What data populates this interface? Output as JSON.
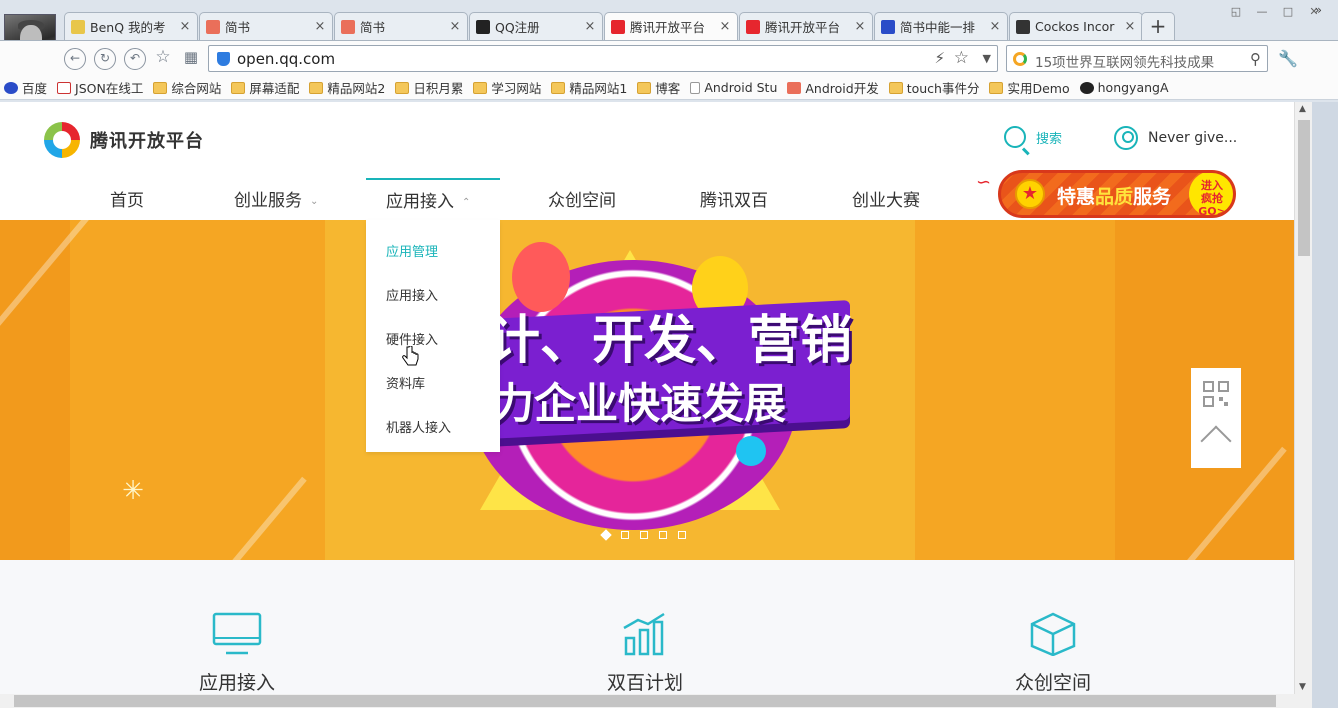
{
  "browser": {
    "tabs": [
      {
        "label": "BenQ 我的考",
        "icon": "benq-page-icon",
        "color": "#e8c64a"
      },
      {
        "label": "简书",
        "icon": "jianshu-icon",
        "color": "#ea6f5a"
      },
      {
        "label": "简书",
        "icon": "jianshu-icon",
        "color": "#ea6f5a"
      },
      {
        "label": "QQ注册",
        "icon": "qq-penguin-icon",
        "color": "#222222"
      },
      {
        "label": "腾讯开放平台",
        "icon": "tencent-open-icon",
        "color": "#e6262e",
        "active": true
      },
      {
        "label": "腾讯开放平台",
        "icon": "tencent-open-icon",
        "color": "#e6262e"
      },
      {
        "label": "简书中能一排",
        "icon": "baidu-paw-icon",
        "color": "#2a4cc8"
      },
      {
        "label": "Cockos Incor",
        "icon": "cockos-icon",
        "color": "#333333"
      }
    ],
    "new_tab_label": "+",
    "url": "open.qq.com",
    "search_text": "15项世界互联网领先科技成果",
    "bookmarks": [
      {
        "label": "百度",
        "icon": "paw"
      },
      {
        "label": "JSON在线工",
        "icon": "json"
      },
      {
        "label": "综合网站",
        "icon": "folder"
      },
      {
        "label": "屏幕适配",
        "icon": "folder"
      },
      {
        "label": "精品网站2",
        "icon": "folder"
      },
      {
        "label": "日积月累",
        "icon": "folder"
      },
      {
        "label": "学习网站",
        "icon": "folder"
      },
      {
        "label": "精品网站1",
        "icon": "folder"
      },
      {
        "label": "博客",
        "icon": "folder"
      },
      {
        "label": "Android Stu",
        "icon": "page"
      },
      {
        "label": "Android开发",
        "icon": "jian"
      },
      {
        "label": "touch事件分",
        "icon": "folder"
      },
      {
        "label": "实用Demo",
        "icon": "folder"
      },
      {
        "label": "hongyangA",
        "icon": "gh"
      }
    ],
    "bookmarks_more": "»"
  },
  "site": {
    "logo_text": "腾讯开放平台",
    "search_label": "搜索",
    "user_label": "Never give...",
    "nav": [
      {
        "label": "首页",
        "has_chevron": false
      },
      {
        "label": "创业服务",
        "has_chevron": true
      },
      {
        "label": "应用接入",
        "has_chevron": true,
        "open": true
      },
      {
        "label": "众创空间",
        "has_chevron": false
      },
      {
        "label": "腾讯双百",
        "has_chevron": false
      },
      {
        "label": "创业大赛",
        "has_chevron": false
      }
    ],
    "promo": {
      "text_a": "特惠",
      "text_b": "品质",
      "text_c": "服务",
      "go_line1": "进入",
      "go_line2": "疯抢",
      "go_line3": "GO>"
    },
    "dropdown": [
      {
        "label": "应用管理",
        "active": true
      },
      {
        "label": "应用接入",
        "active": false
      },
      {
        "label": "硬件接入",
        "active": false
      },
      {
        "label": "资料库",
        "active": false
      },
      {
        "label": "机器人接入",
        "active": false
      }
    ],
    "banner": {
      "line1": "计、开发、营销",
      "line2": "力企业快速发展",
      "slides": 5,
      "current_slide": 1
    },
    "features": [
      {
        "label": "应用接入",
        "icon": "monitor-icon"
      },
      {
        "label": "双百计划",
        "icon": "bar-chart-icon"
      },
      {
        "label": "众创空间",
        "icon": "cube-icon"
      }
    ],
    "accent": "#19b4b9"
  }
}
